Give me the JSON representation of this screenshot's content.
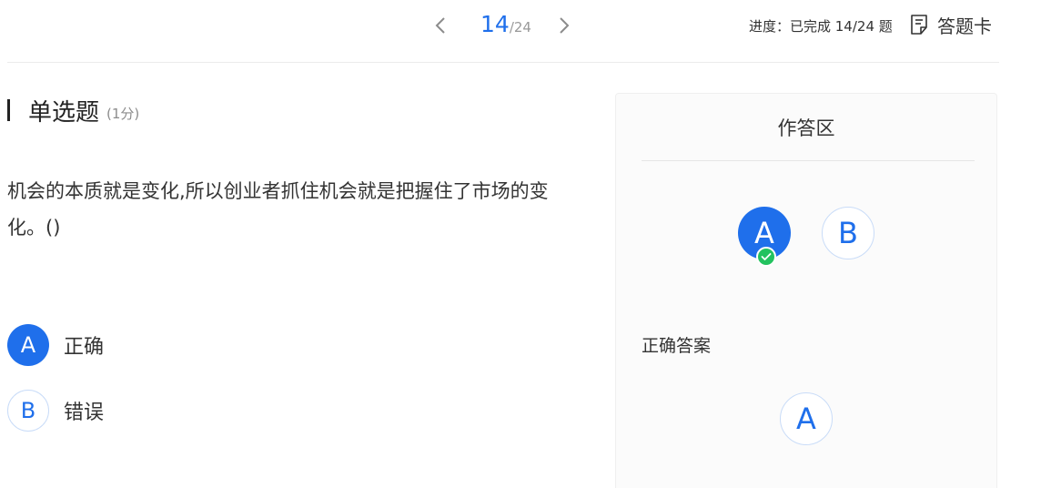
{
  "pager": {
    "current": "14",
    "total": "/24",
    "prev_icon": "chevron-left-icon",
    "next_icon": "chevron-right-icon"
  },
  "header": {
    "progress": "进度：已完成 14/24 题",
    "card_label": "答题卡",
    "card_icon": "answer-sheet-icon"
  },
  "question": {
    "type": "单选题",
    "score": "(1分)",
    "text": "机会的本质就是变化,所以创业者抓住机会就是把握住了市场的变化。()",
    "options": [
      {
        "letter": "A",
        "text": "正确",
        "selected": true
      },
      {
        "letter": "B",
        "text": "错误",
        "selected": false
      }
    ]
  },
  "panel": {
    "title": "作答区",
    "answers": [
      {
        "letter": "A",
        "selected": true
      },
      {
        "letter": "B",
        "selected": false
      }
    ],
    "check_icon": "checkmark-icon",
    "correct_label": "正确答案",
    "correct_answer": "A"
  },
  "colors": {
    "accent": "#1f6feb",
    "success": "#23c25f",
    "text": "#333333",
    "muted": "#8c8c8c"
  }
}
